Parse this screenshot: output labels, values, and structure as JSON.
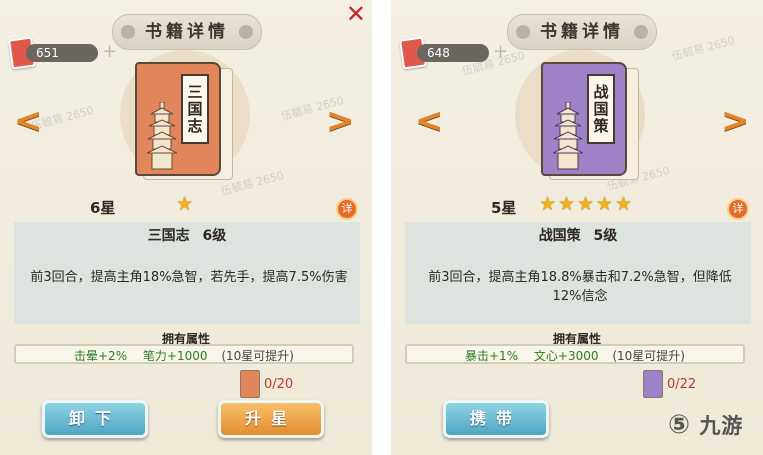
{
  "left": {
    "title": "书籍详情",
    "currency": "651",
    "book_name": "三国志",
    "star_label": "6星",
    "star_count": 1,
    "detail_badge": "详",
    "level_title": "三国志 6级",
    "description": "前3回合，提高主角18%急智，若先手，提高7.5%伤害",
    "attr_header": "拥有属性",
    "attr_a": "击晕+2%",
    "attr_b": "笔力+1000",
    "attr_note": "(10星可提升)",
    "fragment_count": "0/20",
    "button_left": "卸下",
    "button_right": "升星",
    "cover_color": "#e1865b"
  },
  "right": {
    "title": "书籍详情",
    "currency": "648",
    "book_name": "战国策",
    "star_label": "5星",
    "star_count": 5,
    "detail_badge": "详",
    "level_title": "战国策 5级",
    "description": "前3回合，提高主角18.8%暴击和7.2%急智，但降低12%信念",
    "attr_header": "拥有属性",
    "attr_a": "暴击+1%",
    "attr_b": "文心+3000",
    "attr_note": "(10星可提升)",
    "fragment_count": "0/22",
    "button_left": "携带",
    "cover_color": "#9d82c7"
  },
  "watermark": "伍毓易 2650",
  "logo": "九游"
}
